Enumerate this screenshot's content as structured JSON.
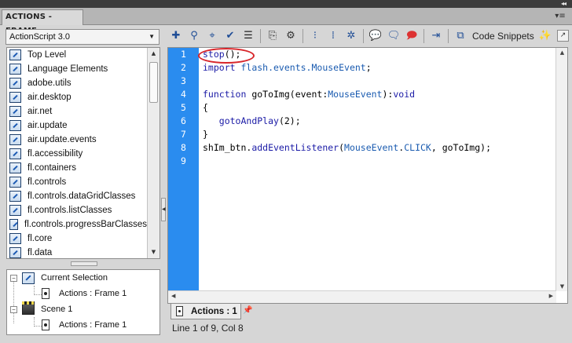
{
  "panel": {
    "tab_title": "ACTIONS - FRAME",
    "collapse_glyph": "◂◂",
    "close_glyph": "✕",
    "menu_glyph": "▾≡"
  },
  "version_select": {
    "value": "ActionScript 3.0"
  },
  "toolbox": {
    "items": [
      "Top Level",
      "Language Elements",
      "adobe.utils",
      "air.desktop",
      "air.net",
      "air.update",
      "air.update.events",
      "fl.accessibility",
      "fl.containers",
      "fl.controls",
      "fl.controls.dataGridClasses",
      "fl.controls.listClasses",
      "fl.controls.progressBarClasses",
      "fl.core",
      "fl.data"
    ]
  },
  "script_navigator": {
    "current_selection": "Current Selection",
    "current_selection_child": "Actions : Frame 1",
    "scene": "Scene 1",
    "scene_child": "Actions : Frame 1"
  },
  "toolbar": {
    "code_snippets_label": "Code Snippets",
    "icons": [
      "add-statement-icon",
      "find-icon",
      "insert-target-path-icon",
      "check-syntax-icon",
      "auto-format-icon",
      "show-code-hint-icon",
      "debug-options-icon",
      "collapse-between-braces-icon",
      "collapse-selection-icon",
      "expand-all-icon",
      "apply-block-comment-icon",
      "apply-line-comment-icon",
      "remove-comment-icon",
      "show-hide-toolbox-icon",
      "code-snippets-icon",
      "wizard-icon"
    ]
  },
  "editor": {
    "line_numbers": [
      "1",
      "2",
      "3",
      "4",
      "5",
      "6",
      "7",
      "8",
      "9"
    ],
    "lines": [
      [
        {
          "t": "stop",
          "c": "fnc"
        },
        {
          "t": "();",
          "c": "plain"
        }
      ],
      [
        {
          "t": "import",
          "c": "kw"
        },
        {
          "t": " flash.events.",
          "c": "cls"
        },
        {
          "t": "MouseEvent",
          "c": "cls"
        },
        {
          "t": ";",
          "c": "plain"
        }
      ],
      [],
      [
        {
          "t": "function",
          "c": "kw"
        },
        {
          "t": " goToImg(event:",
          "c": "plain"
        },
        {
          "t": "MouseEvent",
          "c": "cls"
        },
        {
          "t": "):",
          "c": "plain"
        },
        {
          "t": "void",
          "c": "kw"
        }
      ],
      [
        {
          "t": "{",
          "c": "plain"
        }
      ],
      [
        {
          "t": "   ",
          "c": "plain"
        },
        {
          "t": "gotoAndPlay",
          "c": "fnc"
        },
        {
          "t": "(2);",
          "c": "plain"
        }
      ],
      [
        {
          "t": "}",
          "c": "plain"
        }
      ],
      [
        {
          "t": "shIm_btn.",
          "c": "plain"
        },
        {
          "t": "addEventListener",
          "c": "fnc"
        },
        {
          "t": "(",
          "c": "plain"
        },
        {
          "t": "MouseEvent",
          "c": "cls"
        },
        {
          "t": ".",
          "c": "plain"
        },
        {
          "t": "CLICK",
          "c": "cls"
        },
        {
          "t": ", goToImg);",
          "c": "plain"
        }
      ],
      []
    ]
  },
  "script_tab": {
    "label": "Actions : 1"
  },
  "status": {
    "text": "Line 1 of 9, Col 8"
  },
  "colors": {
    "gutter": "#2a8cef",
    "keyword": "#1a1aa6",
    "class": "#1a5bb0",
    "annotation_circle": "#d8262b"
  }
}
